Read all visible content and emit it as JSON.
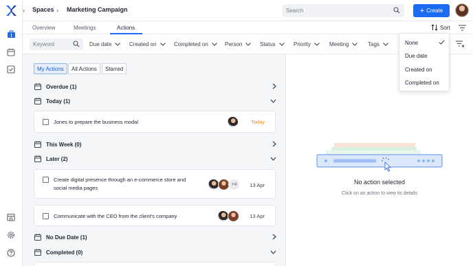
{
  "breadcrumb": {
    "root": "Spaces",
    "current": "Marketing Campaign"
  },
  "search": {
    "placeholder": "Search"
  },
  "create_label": "Create",
  "tabs": [
    {
      "label": "Overview"
    },
    {
      "label": "Meetings"
    },
    {
      "label": "Actions",
      "active": true
    }
  ],
  "sort_label": "Sort",
  "filters": {
    "keyword_placeholder": "Keyword",
    "dropdowns": [
      "Due date",
      "Created on",
      "Completed on",
      "Person",
      "Status",
      "Priority",
      "Meeting",
      "Tags"
    ]
  },
  "chips": [
    {
      "label": "My Actions",
      "selected": true
    },
    {
      "label": "All Actions",
      "selected": false
    },
    {
      "label": "Starred",
      "selected": false
    }
  ],
  "sections": {
    "overdue": "Overdue (1)",
    "today": "Today (1)",
    "this_week": "This Week (0)",
    "later": "Later (2)",
    "no_due_date": "No Due Date (1)",
    "completed": "Completed (0)"
  },
  "actions": {
    "today_item": {
      "text": "Jones to prepare the business modal",
      "date": "Today"
    },
    "later_item_1": {
      "line1": "Create digital presence through an e-commerce store and",
      "line2": "social media pages",
      "more": "+4",
      "date": "13 Apr"
    },
    "later_item_2": {
      "text": "Communicate with the CEO from the client's company",
      "date": "13 Apr"
    }
  },
  "empty_state": {
    "title": "No action selected",
    "subtitle": "Click on an action to view its details"
  },
  "sort_menu": {
    "options": [
      "None",
      "Due date",
      "Created on",
      "Completed on"
    ],
    "selected": "None"
  },
  "colors": {
    "accent": "#1b6cf2",
    "today": "#f08a24"
  }
}
